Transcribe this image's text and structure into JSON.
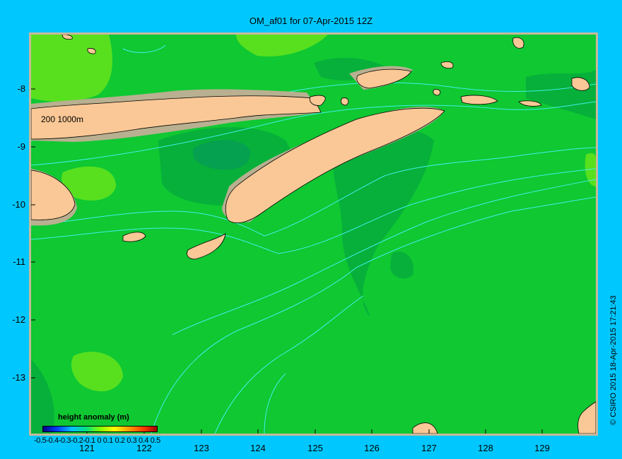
{
  "title": "OM_af01 for 07-Apr-2015 12Z",
  "credit": "© CSIRO 2015   18-Apr-2015 17:21:43",
  "contour_label": "200  1000m",
  "y_axis": {
    "ticks": [
      "-8",
      "-9",
      "-10",
      "-11",
      "-12",
      "-13"
    ]
  },
  "x_axis": {
    "ticks": [
      "121",
      "122",
      "123",
      "124",
      "125",
      "126",
      "127",
      "128",
      "129"
    ]
  },
  "legend": {
    "title": "height anomaly  (m)",
    "labels": "-0.5-0.4-0.3-0.2-0.1 0 0.1 0.2 0.3 0.4 0.5",
    "range": [
      -0.5,
      0.5
    ]
  },
  "colors": {
    "background": "#00c8ff",
    "field_main": "#0fc832",
    "field_dark": "#06b03a",
    "field_light": "#58e01e",
    "land": "#fac896",
    "shelf": "#b8b090",
    "contour": "#40f0e8"
  }
}
